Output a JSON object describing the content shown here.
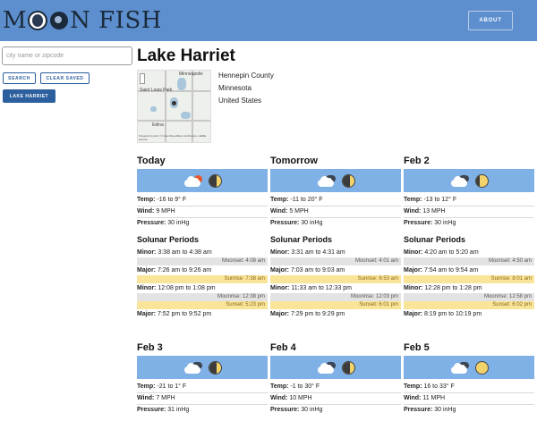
{
  "app": {
    "logo_part1": "M",
    "logo_part2": "N FISH",
    "about_label": "ABOUT"
  },
  "search": {
    "placeholder": "city name or zipcode",
    "value": "",
    "search_label": "SEARCH",
    "clear_label": "CLEAR SAVED"
  },
  "saved": [
    {
      "label": "LAKE HARRIET"
    }
  ],
  "location": {
    "title": "Lake Harriet",
    "county": "Hennepin County",
    "state": "Minnesota",
    "country": "United States",
    "map": {
      "label_top": "Minneapolis",
      "label_left": "Saint Louis Park",
      "label_bottom": "Edina",
      "attribution": "Powered by Esri | © OpenStreetMap contributors, HERE, Garmin"
    }
  },
  "labels": {
    "temp": "Temp:",
    "wind": "Wind:",
    "pressure": "Pressure:",
    "solunar": "Solunar Periods",
    "minor": "Minor:",
    "major": "Major:"
  },
  "days": [
    {
      "name": "Today",
      "weather_icon": "partly-cloudy-sun-icon",
      "moon": "waning-crescent-icon",
      "temp": "-16 to 9° F",
      "wind": "9 MPH",
      "pressure": "30 inHg",
      "minor1": "3:38 am to 4:38 am",
      "moonset": "Moonset: 4:08 am",
      "major1": "7:26 am to 9:26 am",
      "sunrise": "Sunrise: 7:38 am",
      "minor2": "12:08 pm to 1:08 pm",
      "moonrise": "Moonrise: 12:38 pm",
      "sunset": "Sunset: 5:23 pm",
      "major2": "7:52 pm to 9:52 pm"
    },
    {
      "name": "Tomorrow",
      "weather_icon": "cloudy-icon",
      "moon": "waning-crescent-icon",
      "temp": "-11 to 20° F",
      "wind": "5 MPH",
      "pressure": "30 inHg",
      "minor1": "3:31 am to 4:31 am",
      "moonset": "Moonset: 4:01 am",
      "major1": "7:03 am to 9:03 am",
      "sunrise": "Sunrise: 6:53 am",
      "minor2": "11:33 am to 12:33 pm",
      "moonrise": "Moonrise: 12:03 pm",
      "sunset": "Sunset: 6:01 pm",
      "major2": "7:29 pm to 9:29 pm"
    },
    {
      "name": "Feb 2",
      "weather_icon": "cloudy-icon",
      "moon": "waning-gibbous-icon",
      "temp": "-13 to 12° F",
      "wind": "13 MPH",
      "pressure": "30 inHg",
      "minor1": "4:20 am to 5:20 am",
      "moonset": "Moonset: 4:50 am",
      "major1": "7:54 am to 9:54 am",
      "sunrise": "Sunrise: 8:01 am",
      "minor2": "12:28 pm to 1:28 pm",
      "moonrise": "Moonrise: 12:58 pm",
      "sunset": "Sunset: 6:02 pm",
      "major2": "8:19 pm to 10:19 pm"
    },
    {
      "name": "Feb 3",
      "weather_icon": "cloudy-icon",
      "moon": "waning-crescent-icon",
      "temp": "-21 to 1° F",
      "wind": "7 MPH",
      "pressure": "31 inHg"
    },
    {
      "name": "Feb 4",
      "weather_icon": "cloudy-icon",
      "moon": "waning-crescent-icon",
      "temp": "-1 to 30° F",
      "wind": "10 MPH",
      "pressure": "30 inHg"
    },
    {
      "name": "Feb 5",
      "weather_icon": "cloudy-icon",
      "moon": "full-moon-icon",
      "temp": "16 to 33° F",
      "wind": "11 MPH",
      "pressure": "30 inHg"
    }
  ]
}
